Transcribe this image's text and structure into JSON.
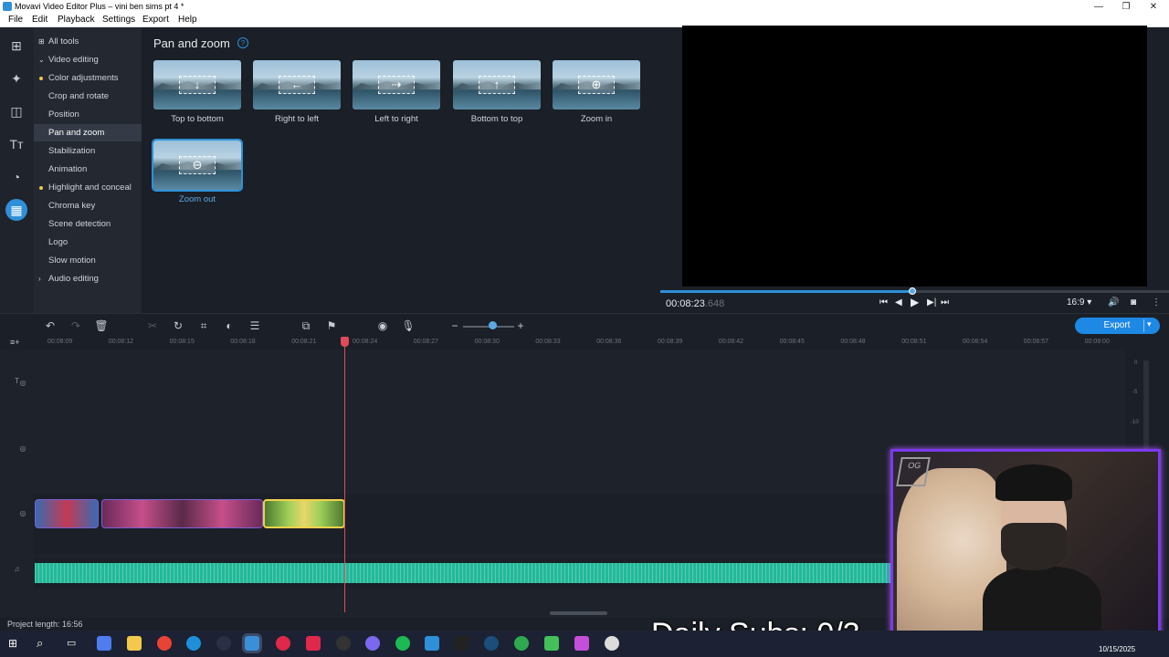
{
  "window": {
    "title": "Movavi Video Editor Plus – vini ben sims pt 4 *",
    "min_label": "—",
    "restore_label": "❐",
    "close_label": "✕"
  },
  "menu": [
    "File",
    "Edit",
    "Playback",
    "Settings",
    "Export",
    "Help"
  ],
  "rail_icons": [
    "import-icon",
    "magic-wand-icon",
    "transitions-icon",
    "text-icon",
    "stickers-icon",
    "more-tools-icon"
  ],
  "tools_nav": {
    "all_tools": "All tools",
    "video_editing": "Video editing",
    "items": [
      {
        "label": "Color adjustments",
        "dot": true
      },
      {
        "label": "Crop and rotate",
        "dot": false
      },
      {
        "label": "Position",
        "dot": false
      },
      {
        "label": "Pan and zoom",
        "dot": false,
        "selected": true
      },
      {
        "label": "Stabilization",
        "dot": false
      },
      {
        "label": "Animation",
        "dot": false
      },
      {
        "label": "Highlight and conceal",
        "dot": true
      },
      {
        "label": "Chroma key",
        "dot": false
      },
      {
        "label": "Scene detection",
        "dot": false
      },
      {
        "label": "Logo",
        "dot": false
      },
      {
        "label": "Slow motion",
        "dot": false
      }
    ],
    "audio_editing": "Audio editing"
  },
  "panel": {
    "title": "Pan and zoom",
    "help": "?",
    "presets": [
      {
        "label": "Top to bottom",
        "glyph": "↓"
      },
      {
        "label": "Right to left",
        "glyph": "←"
      },
      {
        "label": "Left to right",
        "glyph": "⇢"
      },
      {
        "label": "Bottom to top",
        "glyph": "↑"
      },
      {
        "label": "Zoom in",
        "glyph": "⊕"
      },
      {
        "label": "Zoom out",
        "glyph": "⊖",
        "selected": true
      }
    ]
  },
  "player": {
    "timecode_main": "00:08:23",
    "timecode_ms": ".648",
    "progress": 0.495,
    "aspect": "16:9 ▾",
    "controls": [
      "⏮",
      "◀",
      "▶",
      "▶|",
      "⏭"
    ]
  },
  "timeline": {
    "export_label": "Export",
    "export_chevron": "▾",
    "ruler_ticks": [
      "00:08:09",
      "00:08:12",
      "00:08:15",
      "00:08:18",
      "00:08:21",
      "00:08:24",
      "00:08:27",
      "00:08:30",
      "00:08:33",
      "00:08:36",
      "00:08:39",
      "00:08:42",
      "00:08:45",
      "00:08:48",
      "00:08:51",
      "00:08:54",
      "00:08:57",
      "00:09:00"
    ],
    "meter_labels": [
      "0",
      "-5",
      "-10"
    ],
    "zoom_level": 0.57
  },
  "status": {
    "project_length": "Project length: 16:56"
  },
  "overlay": {
    "daily_subs": "Daily Subs: 0/3",
    "webcam_logo": "OG"
  },
  "taskbar": {
    "date": "10/15/2025"
  }
}
